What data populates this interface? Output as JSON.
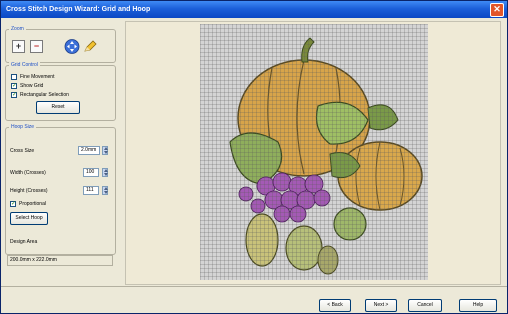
{
  "window": {
    "title": "Cross Stitch Design Wizard: Grid and Hoop",
    "close_glyph": "✕"
  },
  "zoom": {
    "legend": "Zoom",
    "zoom_in_glyph": "+",
    "zoom_out_glyph": "−"
  },
  "grid_control": {
    "legend": "Grid Control",
    "fine_movement": {
      "label": "Fine Movement",
      "checked": false
    },
    "show_grid": {
      "label": "Show Grid",
      "checked": true
    },
    "rectangular_selection": {
      "label": "Rectangular Selection",
      "checked": true
    },
    "reset_label": "Reset"
  },
  "hoop_size": {
    "legend": "Hoop Size",
    "cross_size_label": "Cross Size",
    "cross_size_value": "2.0mm",
    "width_label": "Width (Crosses)",
    "width_value": "100",
    "height_label": "Height (Crosses)",
    "height_value": "111",
    "proportional": {
      "label": "Proportional",
      "checked": true
    },
    "select_hoop_label": "Select Hoop"
  },
  "design_area": {
    "label": "Design Area",
    "value": "200.0mm x 222.0mm"
  },
  "footer": {
    "back_label": "< Back",
    "next_label": "Next >",
    "cancel_label": "Cancel",
    "help_label": "Help"
  },
  "icons": {
    "close": "close-icon",
    "zoom_in": "zoom-in-icon",
    "zoom_out": "zoom-out-icon",
    "move": "move-arrows-icon",
    "pencil": "pencil-icon"
  },
  "colors": {
    "titlebar": "#1c5fd9",
    "pumpkin": "#d7a44a",
    "leaf": "#8fae5c",
    "grapes": "#a45ab5",
    "background": "#efead6"
  }
}
